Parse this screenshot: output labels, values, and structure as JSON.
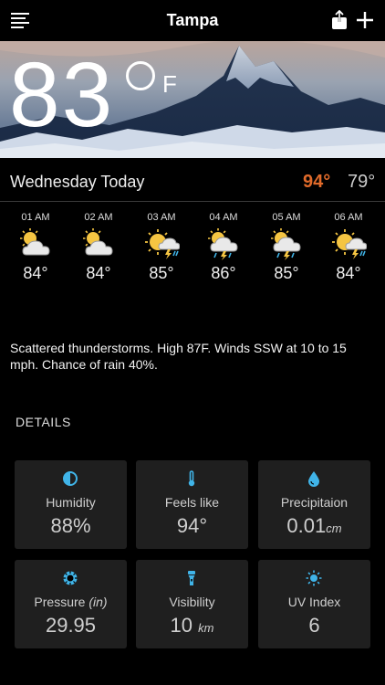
{
  "header": {
    "city": "Tampa"
  },
  "current": {
    "temp": "83",
    "unit": "F"
  },
  "today": {
    "label": "Wednesday Today",
    "high": "94°",
    "low": "79°"
  },
  "hourly": [
    {
      "time": "01 AM",
      "icon": "partly-cloudy-icon",
      "temp": "84°"
    },
    {
      "time": "02 AM",
      "icon": "partly-cloudy-icon",
      "temp": "84°"
    },
    {
      "time": "03 AM",
      "icon": "sun-storm-icon",
      "temp": "85°"
    },
    {
      "time": "04 AM",
      "icon": "sun-storm-rain-icon",
      "temp": "86°"
    },
    {
      "time": "05 AM",
      "icon": "sun-storm-rain-icon",
      "temp": "85°"
    },
    {
      "time": "06 AM",
      "icon": "sun-storm-icon",
      "temp": "84°"
    }
  ],
  "summary": "Scattered thunderstorms. High 87F. Winds SSW at 10 to 15 mph. Chance of rain 40%.",
  "details": {
    "title": "DETAILS",
    "items": [
      {
        "label": "Humidity",
        "label_unit": "",
        "value": "88%",
        "unit": "",
        "icon": "humidity-icon"
      },
      {
        "label": "Feels like",
        "label_unit": "",
        "value": "94°",
        "unit": "",
        "icon": "thermometer-icon"
      },
      {
        "label": "Precipitaion",
        "label_unit": "",
        "value": "0.01",
        "unit": "cm",
        "icon": "raindrop-icon"
      },
      {
        "label": "Pressure ",
        "label_unit": "(in)",
        "value": "29.95",
        "unit": "",
        "icon": "pressure-icon"
      },
      {
        "label": "Visibility",
        "label_unit": "",
        "value": "10 ",
        "unit": "km",
        "icon": "flashlight-icon"
      },
      {
        "label": "UV Index",
        "label_unit": "",
        "value": "6",
        "unit": "",
        "icon": "sun-icon"
      }
    ]
  },
  "colors": {
    "accent": "#40b4e8",
    "high": "#e06a2a",
    "tile": "#1f1f1f"
  }
}
